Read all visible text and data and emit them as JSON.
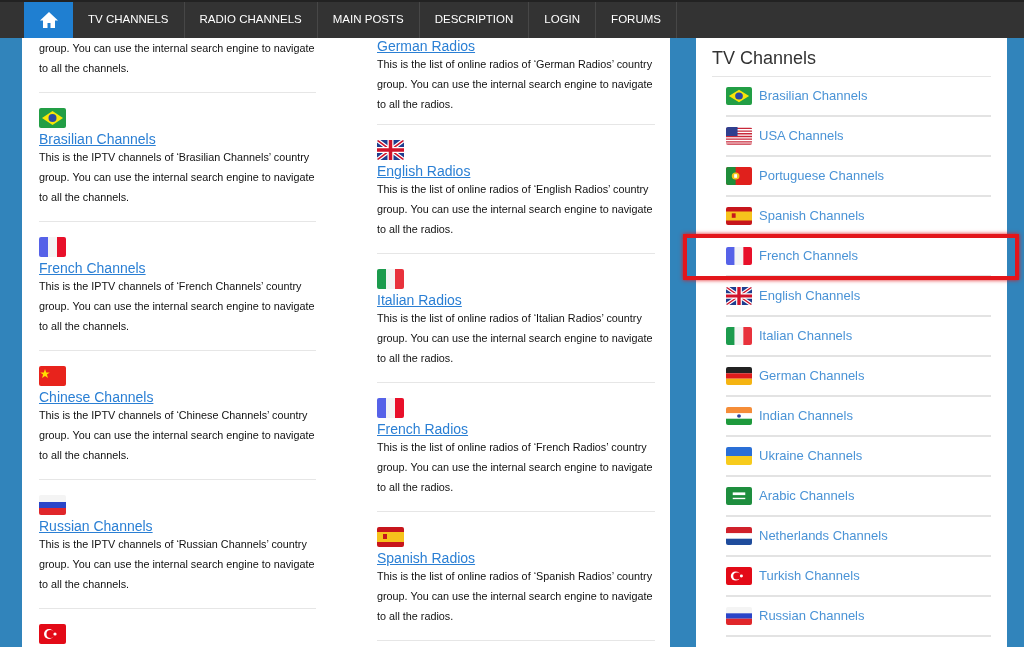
{
  "nav": {
    "home": {
      "selected": true
    },
    "items": [
      {
        "label": "TV CHANNELS",
        "selected": false
      },
      {
        "label": "RADIO CHANNELS",
        "selected": false
      },
      {
        "label": "MAIN POSTS",
        "selected": false
      },
      {
        "label": "DESCRIPTION",
        "selected": false
      },
      {
        "label": "LOGIN",
        "selected": false
      },
      {
        "label": "FORUMS",
        "selected": false
      }
    ]
  },
  "channel_posts": [
    {
      "description": "group. You can use the internal search engine to navigate to all the channels."
    },
    {
      "title": "Brasilian Channels",
      "description": "This is the IPTV channels of ‘Brasilian Channels’ country group. You can use the internal search engine to navigate to all the channels."
    },
    {
      "title": "French Channels",
      "description": "This is the IPTV channels of ‘French Channels’ country group. You can use the internal search engine to navigate to all the channels."
    },
    {
      "title": "Chinese Channels",
      "description": "This is the IPTV channels of ‘Chinese Channels’ country group. You can use the internal search engine to navigate to all the channels."
    },
    {
      "title": "Russian Channels",
      "description": "This is the IPTV channels of ‘Russian Channels’ country group. You can use the internal search engine to navigate to all the channels."
    }
  ],
  "radio_posts": [
    {
      "title": "German Radios",
      "description": "This is the list of online radios of ‘German Radios’ country group. You can use the internal search engine to navigate to all the radios."
    },
    {
      "title": "English Radios",
      "description": "This is the list of online radios of ‘English Radios’ country group. You can use the internal search engine to navigate to all the radios."
    },
    {
      "title": "Italian Radios",
      "description": "This is the list of online radios of ‘Italian Radios’ country group. You can use the internal search engine to navigate to all the radios."
    },
    {
      "title": "French Radios",
      "description": "This is the list of online radios of ‘French Radios’ country group. You can use the internal search engine to navigate to all the radios."
    },
    {
      "title": "Spanish Radios",
      "description": "This is the list of online radios of ‘Spanish Radios’ country group. You can use the internal search engine to navigate to all the radios."
    }
  ],
  "sidebar": {
    "title": "TV Channels",
    "items": [
      {
        "label": "Brasilian Channels",
        "highlighted": false
      },
      {
        "label": "USA Channels",
        "highlighted": false
      },
      {
        "label": "Portuguese Channels",
        "highlighted": false
      },
      {
        "label": "Spanish Channels",
        "highlighted": false
      },
      {
        "label": "French Channels",
        "highlighted": true
      },
      {
        "label": "English Channels",
        "highlighted": false
      },
      {
        "label": "Italian Channels",
        "highlighted": false
      },
      {
        "label": "German Channels",
        "highlighted": false
      },
      {
        "label": "Indian Channels",
        "highlighted": false
      },
      {
        "label": "Ukraine Channels",
        "highlighted": false
      },
      {
        "label": "Arabic Channels",
        "highlighted": false
      },
      {
        "label": "Netherlands Channels",
        "highlighted": false
      },
      {
        "label": "Turkish Channels",
        "highlighted": false
      },
      {
        "label": "Russian Channels",
        "highlighted": false
      }
    ]
  }
}
